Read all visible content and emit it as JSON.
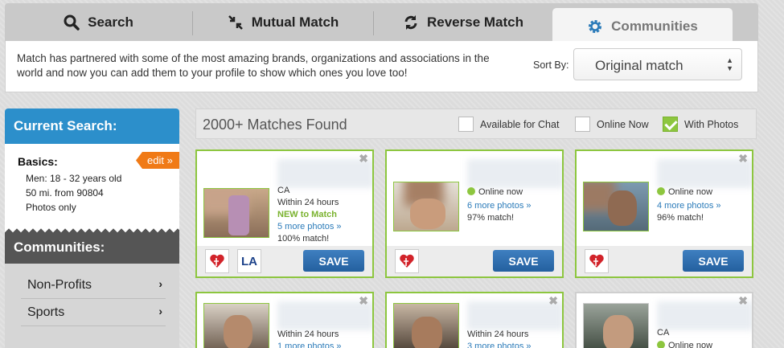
{
  "tabs": [
    {
      "label": "Search",
      "icon": "search-icon"
    },
    {
      "label": "Mutual Match",
      "icon": "arrows-icon"
    },
    {
      "label": "Reverse Match",
      "icon": "reverse-icon"
    },
    {
      "label": "Communities",
      "icon": "gear-icon",
      "active": true
    }
  ],
  "info": {
    "text": "Match has partnered with some of the most amazing brands, organizations and associations in the world and now you can add them to your profile to show which ones you love too!",
    "sort_label": "Sort By:",
    "sort_value": "Original match"
  },
  "sidebar": {
    "current_search_title": "Current Search:",
    "basics_title": "Basics:",
    "edit_label": "edit »",
    "basics_lines": [
      "Men: 18 - 32 years old",
      "50 mi. from 90804",
      "Photos only"
    ],
    "communities_title": "Communities:",
    "communities": [
      "Non-Profits",
      "Sports"
    ]
  },
  "results": {
    "matches_found": "2000+ Matches Found",
    "filters": [
      {
        "label": "Available for Chat",
        "checked": false
      },
      {
        "label": "Online Now",
        "checked": false
      },
      {
        "label": "With Photos",
        "checked": true
      }
    ]
  },
  "cards": [
    {
      "lines": [
        "CA",
        "Within 24 hours",
        "NEW to Match",
        "5 more photos »",
        "100% match!"
      ],
      "save": "SAVE"
    },
    {
      "lines": [
        "Online now",
        "6 more photos »",
        "97% match!"
      ],
      "save": "SAVE"
    },
    {
      "lines": [
        "Online now",
        "4 more photos »",
        "96% match!"
      ],
      "save": "SAVE"
    },
    {
      "lines": [
        "Within 24 hours",
        "1 more photos »"
      ]
    },
    {
      "lines": [
        "Within 24 hours",
        "3 more photos »"
      ]
    },
    {
      "lines": [
        "CA",
        "Online now"
      ]
    }
  ],
  "colors": {
    "accent_blue": "#2c8fcb",
    "match_green": "#8dc63f",
    "edit_orange": "#f07a16",
    "save_blue": "#2e6eae"
  }
}
